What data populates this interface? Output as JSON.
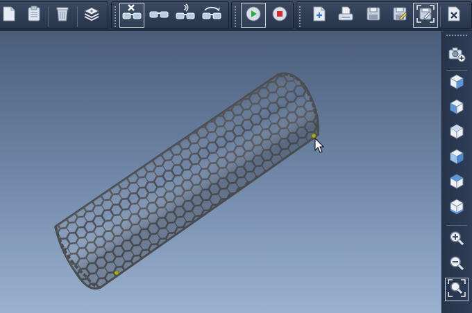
{
  "toolbar": {
    "groups": [
      {
        "name": "clipboard",
        "items": [
          "new-document-icon",
          "clipboard-icon",
          "trash-icon",
          "layers-icon"
        ]
      },
      {
        "name": "stereo-view",
        "items": [
          "stereo-off-icon",
          "stereo-glasses-icon",
          "stereo-sound-icon",
          "stereo-rotate-icon"
        ]
      },
      {
        "name": "playback",
        "items": [
          "play-icon",
          "stop-icon"
        ]
      },
      {
        "name": "file",
        "items": [
          "new-file-icon",
          "print-icon",
          "save-icon",
          "save-as-icon",
          "save-selection-icon",
          "close-file-icon"
        ]
      }
    ]
  },
  "sidebar": {
    "items": [
      "camera-add-icon",
      "view-cube-front-icon",
      "view-cube-left-icon",
      "view-cube-right-icon",
      "view-cube-back-icon",
      "view-cube-top-icon",
      "view-cube-bottom-icon",
      "zoom-in-icon",
      "zoom-out-icon",
      "zoom-fit-icon"
    ]
  },
  "viewport": {
    "model": "carbon-nanotube",
    "atom_color": "#4a4d52",
    "highlight_color": "#a8ab1f",
    "background_top": "#4a5e7a",
    "background_bottom": "#9ab2d0"
  }
}
